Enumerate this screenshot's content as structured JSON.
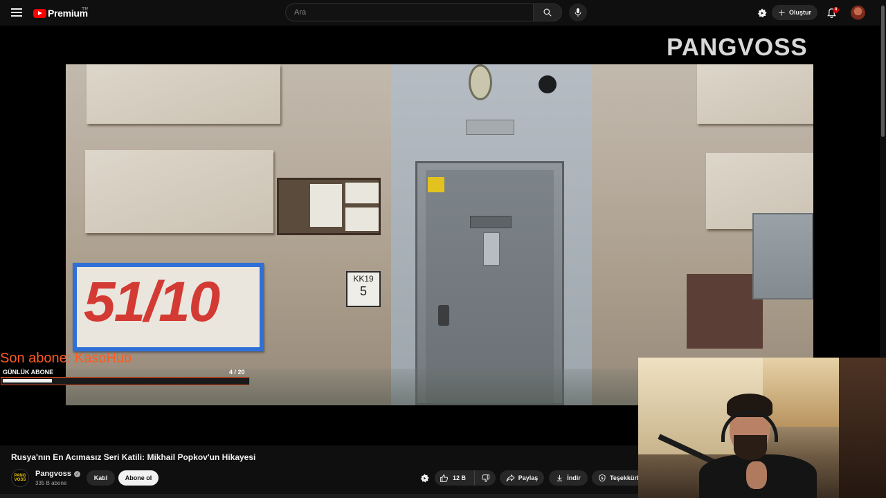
{
  "header": {
    "brand": "Premium",
    "region": "TR",
    "search_placeholder": "Ara",
    "create_label": "Oluştur",
    "notification_count": "4"
  },
  "player": {
    "watermark": "PANGVOSS",
    "scene_sign_number": "51/10",
    "scene_kk_sign_top": "KK19",
    "scene_kk_sign_bottom": "5"
  },
  "overlay": {
    "last_subscriber": "Son abone: KasoHub",
    "daily_label": "GÜNLÜK ABONE",
    "daily_count": "4  / 20",
    "daily_progress": 0.2,
    "accent_color": "#e24a1d"
  },
  "video": {
    "title": "Rusya'nın En Acımasız Seri Katili: Mikhail Popkov'un Hikayesi",
    "channel_name": "Pangvoss",
    "channel_avatar_text": "PANG VOSS",
    "subscriber_count": "335 B abone",
    "join_label": "Katıl",
    "subscribe_label": "Abone ol",
    "like_count": "12 B",
    "share_label": "Paylaş",
    "download_label": "İndir",
    "thanks_label": "Teşekkürl"
  },
  "icons": {
    "menu": "hamburger-icon",
    "search": "search-icon",
    "mic": "mic-icon",
    "premium": "premium-badge-icon",
    "create": "plus-icon",
    "notifications": "bell-icon",
    "like": "thumbs-up-icon",
    "dislike": "thumbs-down-icon",
    "share": "share-arrow-icon",
    "download": "download-icon",
    "thanks": "thanks-icon",
    "verified": "verified-check-icon"
  }
}
